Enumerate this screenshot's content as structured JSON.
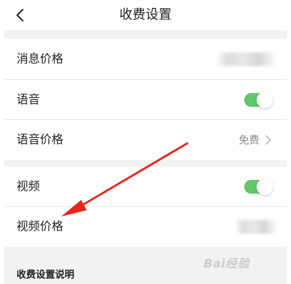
{
  "header": {
    "title": "收费设置"
  },
  "rows": {
    "message_price": {
      "label": "消息价格"
    },
    "voice": {
      "label": "语音",
      "toggle_on": true
    },
    "voice_price": {
      "label": "语音价格",
      "value": "免费"
    },
    "video": {
      "label": "视频",
      "toggle_on": true
    },
    "video_price": {
      "label": "视频价格"
    }
  },
  "section": {
    "title": "收费设置说明"
  },
  "watermark": {
    "text": "Bai经验"
  },
  "colors": {
    "toggle_on": "#5fc86b",
    "background_gap": "#f2f2f2",
    "arrow": "#e8241c"
  },
  "icons": [
    "back-arrow-icon",
    "chevron-right-icon",
    "red-annotation-arrow"
  ]
}
